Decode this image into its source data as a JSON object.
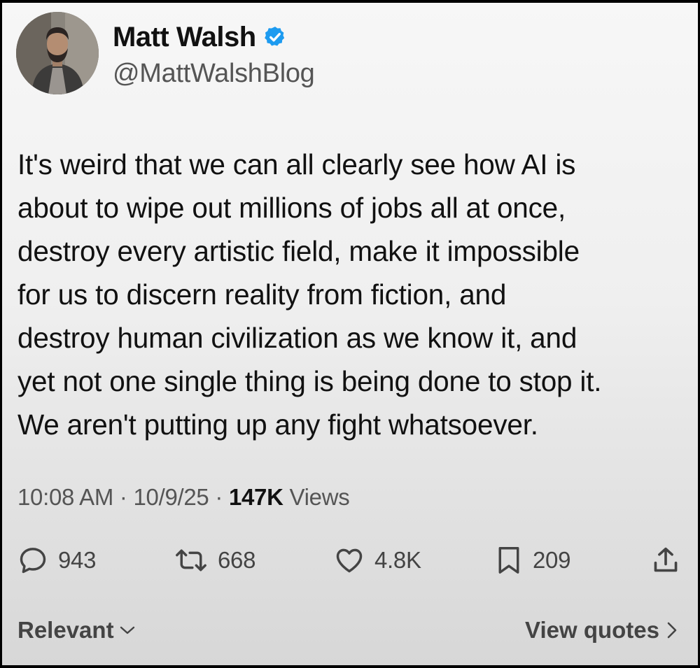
{
  "author": {
    "display_name": "Matt Walsh",
    "handle": "@MattWalshBlog",
    "verified_icon": "verified-badge-icon",
    "verified_color": "#1d9bf0"
  },
  "tweet": {
    "lines": [
      "It's weird that we can all clearly see how AI is",
      "about to wipe out millions of jobs all at once,",
      "destroy every artistic field, make it impossible",
      "for us to discern reality from fiction, and",
      "destroy human civilization as we know it, and",
      "yet not one single thing is being done to stop it.",
      "We aren't putting up any fight whatsoever."
    ]
  },
  "meta": {
    "time": "10:08 AM",
    "separator": "·",
    "date": "10/9/25",
    "views_count": "147K",
    "views_label": "Views"
  },
  "actions": {
    "reply": {
      "icon": "reply-icon",
      "count": "943"
    },
    "repost": {
      "icon": "repost-icon",
      "count": "668"
    },
    "like": {
      "icon": "heart-icon",
      "count": "4.8K"
    },
    "bookmark": {
      "icon": "bookmark-icon",
      "count": "209"
    },
    "share": {
      "icon": "share-icon"
    }
  },
  "footer": {
    "sort_label": "Relevant",
    "view_quotes_label": "View quotes"
  }
}
